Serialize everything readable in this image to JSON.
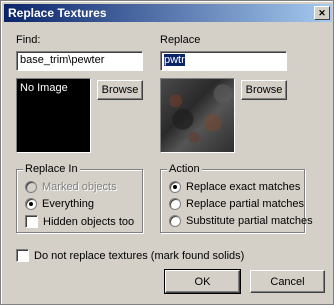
{
  "window": {
    "title": "Replace Textures",
    "close_glyph": "✕"
  },
  "find": {
    "label": "Find:",
    "value": "base_trim\\pewter",
    "preview_text": "No Image",
    "browse_label": "Browse"
  },
  "replace": {
    "label": "Replace",
    "value": "pwtr",
    "browse_label": "Browse"
  },
  "replace_in": {
    "legend": "Replace In",
    "options": [
      {
        "label": "Marked objects",
        "selected": false,
        "enabled": false
      },
      {
        "label": "Everything",
        "selected": true,
        "enabled": true
      }
    ],
    "hidden_checkbox": {
      "label": "Hidden objects too",
      "checked": false
    }
  },
  "action": {
    "legend": "Action",
    "options": [
      {
        "label": "Replace exact matches",
        "selected": true
      },
      {
        "label": "Replace partial matches",
        "selected": false
      },
      {
        "label": "Substitute partial matches",
        "selected": false
      }
    ]
  },
  "no_replace_checkbox": {
    "label": "Do not replace textures (mark found solids)",
    "checked": false
  },
  "buttons": {
    "ok": "OK",
    "cancel": "Cancel"
  },
  "colors": {
    "titlebar_start": "#0a246a",
    "titlebar_end": "#a6caf0",
    "dialog_bg": "#d4d0c8"
  }
}
